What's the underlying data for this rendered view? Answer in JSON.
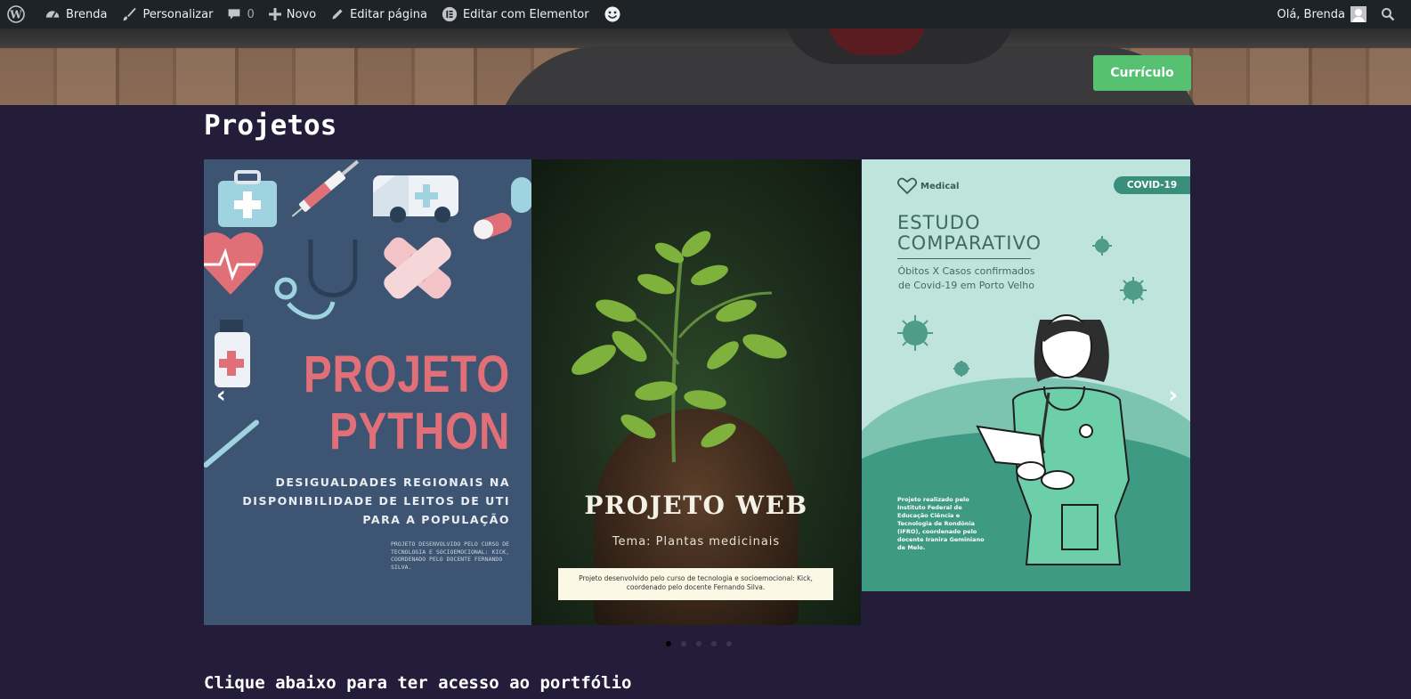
{
  "adminbar": {
    "wp_logo": "wordpress-logo-icon",
    "site_name": "Brenda",
    "customize": "Personalizar",
    "comments_count": "0",
    "new": "Novo",
    "edit_page": "Editar página",
    "edit_elementor": "Editar com Elementor",
    "greeting": "Olá, Brenda"
  },
  "hero": {
    "button_label": "Currículo",
    "button_color": "#56c271"
  },
  "page": {
    "title": "Projetos",
    "subtitle": "Clique abaixo para ter acesso ao portfólio",
    "background": "#241d3a"
  },
  "carousel": {
    "prev_glyph": "‹",
    "next_glyph": "›",
    "active_index": 0,
    "dot_count": 5,
    "slides": [
      {
        "title_line1": "PROJETO",
        "title_line2": "PYTHON",
        "subtitle": "DESIGUALDADES REGIONAIS NA DISPONIBILIDADE DE LEITOS DE UTI PARA A POPULAÇÃO",
        "credits": "PROJETO DESENVOLVIDO PELO CURSO DE TECNOLOGIA E SOCIOEMOCIONAL: KICK, COORDENADO PELO DOCENTE FERNANDO SILVA."
      },
      {
        "title": "PROJETO WEB",
        "tema": "Tema: Plantas medicinais",
        "note": "Projeto desenvolvido pelo curso de tecnologia e socioemocional: Kick, coordenado pelo docente Fernando Silva."
      },
      {
        "brand": "Medical",
        "badge": "COVID-19",
        "title_line1": "ESTUDO",
        "title_line2": "COMPARATIVO",
        "subtitle": "Óbitos X Casos confirmados de Covid-19 em Porto Velho",
        "credits": "Projeto realizado pelo Instituto Federal de Educação Ciência e Tecnologia de Rondônia (IFRO), coordenado pelo docente Iranira Geminiano de Melo."
      }
    ]
  }
}
